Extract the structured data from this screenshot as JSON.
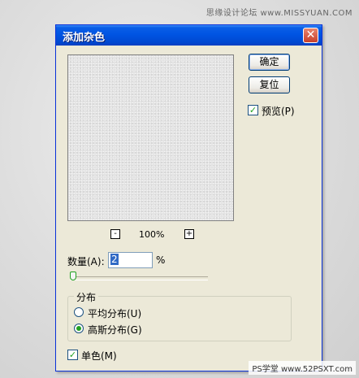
{
  "watermarks": {
    "top": "思缘设计论坛 www.MISSYUAN.COM",
    "bottom": "PS学堂 www.52PSXT.com"
  },
  "dialog": {
    "title": "添加杂色",
    "close_glyph": "✕",
    "ok_label": "确定",
    "reset_label": "复位",
    "preview_label": "预览(P)",
    "preview_checked": true,
    "zoom": {
      "minus": "-",
      "plus": "+",
      "value": "100%"
    },
    "amount": {
      "label": "数量(A):",
      "value": "2",
      "unit": "%"
    },
    "slider_fraction": 0.01,
    "distribution": {
      "title": "分布",
      "options": [
        {
          "label": "平均分布(U)",
          "selected": false
        },
        {
          "label": "高斯分布(G)",
          "selected": true
        }
      ]
    },
    "monochrome": {
      "label": "单色(M)",
      "checked": true
    },
    "check_glyph": "✓"
  }
}
